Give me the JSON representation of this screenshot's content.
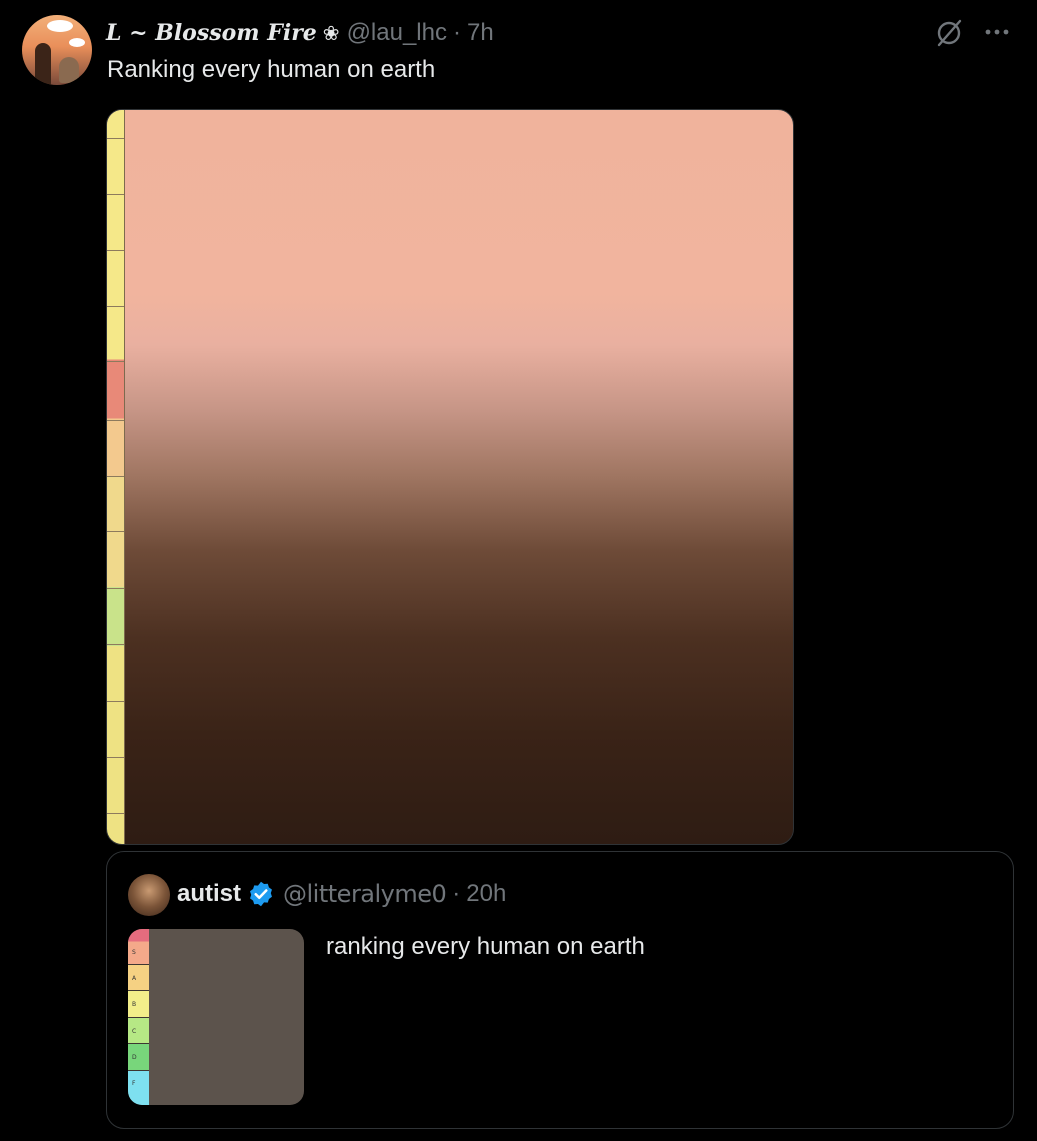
{
  "tweet": {
    "author": {
      "display_name": "L ~ Blossom Fire",
      "name_emoji": "❀",
      "handle": "@lau_lhc",
      "time": "7h",
      "separator": "·"
    },
    "text": "Ranking every human on earth",
    "icons": {
      "grok": "grok-icon",
      "more": "more-icon"
    }
  },
  "quote": {
    "author": {
      "display_name": "autist",
      "handle": "@litteralyme0",
      "time": "20h",
      "separator": "·",
      "verified": true
    },
    "text": "ranking every human on earth",
    "thumbnail_tiers": [
      "S",
      "A",
      "B",
      "C",
      "D",
      "F"
    ]
  },
  "colors": {
    "background": "#000000",
    "primary_text": "#e7e9ea",
    "secondary_text": "#71767b",
    "border": "#2f3336",
    "verified_blue": "#1d9bf0"
  }
}
